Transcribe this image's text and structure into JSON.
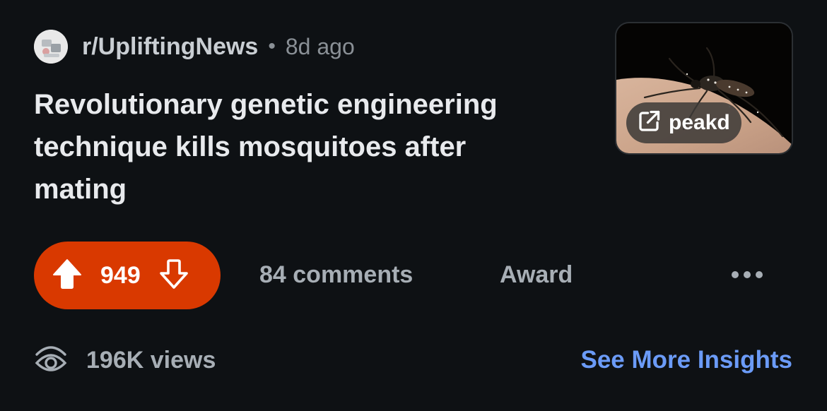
{
  "post": {
    "subreddit": "r/UpliftingNews",
    "separator": "•",
    "age": "8d ago",
    "title": "Revolutionary genetic engineering technique kills mosquitoes after mating",
    "link_domain": "peakd"
  },
  "actions": {
    "score": "949",
    "comments": "84 comments",
    "award": "Award"
  },
  "footer": {
    "views": "196K views",
    "insights": "See More Insights"
  },
  "colors": {
    "background": "#0e1114",
    "vote_pill": "#d93900",
    "insights_link": "#6b9bf7"
  },
  "icons": {
    "upvote": "upvote-arrow-icon",
    "downvote": "downvote-arrow-icon",
    "external_link": "external-link-icon",
    "more": "more-horizontal-icon",
    "views": "eye-icon"
  }
}
